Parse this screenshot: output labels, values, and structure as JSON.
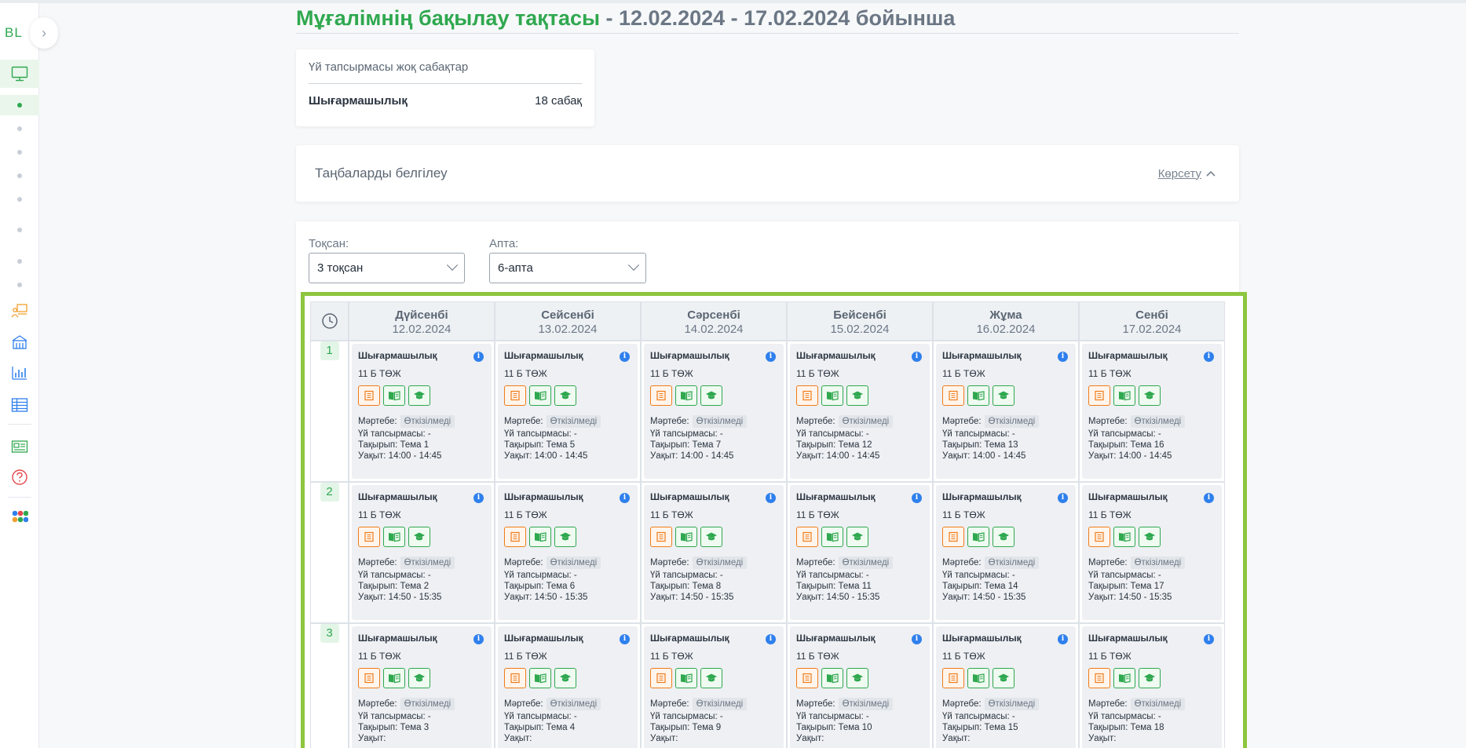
{
  "sidebar": {
    "logo": "BL"
  },
  "page": {
    "title_main": "Мұғалімнің бақылау тақтасы",
    "title_rest": " - 12.02.2024 - 17.02.2024 бойынша"
  },
  "homework_card": {
    "title": "Үй тапсырмасы жоқ сабақтар",
    "subject": "Шығармашылық",
    "count": "18 сабақ"
  },
  "grades_card": {
    "title": "Таңбаларды белгілеу",
    "toggle_label": "Көрсету"
  },
  "filters": {
    "quarter_label": "Тоқсан:",
    "quarter_value": "3 тоқсан",
    "week_label": "Апта:",
    "week_value": "6-апта"
  },
  "schedule": {
    "days": [
      {
        "name": "Дүйсенбі",
        "date": "12.02.2024"
      },
      {
        "name": "Сейсенбі",
        "date": "13.02.2024"
      },
      {
        "name": "Сәрсенбі",
        "date": "14.02.2024"
      },
      {
        "name": "Бейсенбі",
        "date": "15.02.2024"
      },
      {
        "name": "Жұма",
        "date": "16.02.2024"
      },
      {
        "name": "Сенбі",
        "date": "17.02.2024"
      }
    ],
    "lesson_labels": {
      "status_label": "Мәртебе:",
      "status_value": "Өткізілмеді",
      "homework_label": "Үй тапсырмасы:",
      "homework_value": "-",
      "topic_label": "Тақырып:",
      "time_label": "Уақыт:"
    },
    "rows": [
      {
        "number": "1",
        "lessons": [
          {
            "subject": "Шығармашылық",
            "class": "11 Б ТӨЖ",
            "topic": "Тема 1",
            "time": "14:00 - 14:45"
          },
          {
            "subject": "Шығармашылық",
            "class": "11 Б ТӨЖ",
            "topic": "Тема 5",
            "time": "14:00 - 14:45"
          },
          {
            "subject": "Шығармашылық",
            "class": "11 Б ТӨЖ",
            "topic": "Тема 7",
            "time": "14:00 - 14:45"
          },
          {
            "subject": "Шығармашылық",
            "class": "11 Б ТӨЖ",
            "topic": "Тема 12",
            "time": "14:00 - 14:45"
          },
          {
            "subject": "Шығармашылық",
            "class": "11 Б ТӨЖ",
            "topic": "Тема 13",
            "time": "14:00 - 14:45"
          },
          {
            "subject": "Шығармашылық",
            "class": "11 Б ТӨЖ",
            "topic": "Тема 16",
            "time": "14:00 - 14:45"
          }
        ]
      },
      {
        "number": "2",
        "lessons": [
          {
            "subject": "Шығармашылық",
            "class": "11 Б ТӨЖ",
            "topic": "Тема 2",
            "time": "14:50 - 15:35"
          },
          {
            "subject": "Шығармашылық",
            "class": "11 Б ТӨЖ",
            "topic": "Тема 6",
            "time": "14:50 - 15:35"
          },
          {
            "subject": "Шығармашылық",
            "class": "11 Б ТӨЖ",
            "topic": "Тема 8",
            "time": "14:50 - 15:35"
          },
          {
            "subject": "Шығармашылық",
            "class": "11 Б ТӨЖ",
            "topic": "Тема 11",
            "time": "14:50 - 15:35"
          },
          {
            "subject": "Шығармашылық",
            "class": "11 Б ТӨЖ",
            "topic": "Тема 14",
            "time": "14:50 - 15:35"
          },
          {
            "subject": "Шығармашылық",
            "class": "11 Б ТӨЖ",
            "topic": "Тема 17",
            "time": "14:50 - 15:35"
          }
        ]
      },
      {
        "number": "3",
        "lessons": [
          {
            "subject": "Шығармашылық",
            "class": "11 Б ТӨЖ",
            "topic": "Тема 3",
            "time": ""
          },
          {
            "subject": "Шығармашылық",
            "class": "11 Б ТӨЖ",
            "topic": "Тема 4",
            "time": ""
          },
          {
            "subject": "Шығармашылық",
            "class": "11 Б ТӨЖ",
            "topic": "Тема 9",
            "time": ""
          },
          {
            "subject": "Шығармашылық",
            "class": "11 Б ТӨЖ",
            "topic": "Тема 10",
            "time": ""
          },
          {
            "subject": "Шығармашылық",
            "class": "11 Б ТӨЖ",
            "topic": "Тема 15",
            "time": ""
          },
          {
            "subject": "Шығармашылық",
            "class": "11 Б ТӨЖ",
            "topic": "Тема 18",
            "time": ""
          }
        ]
      }
    ]
  },
  "colors": {
    "accent_green": "#2fa84f",
    "highlight_border": "#8dc63f",
    "orange": "#f07c1a",
    "info_blue": "#2f80ed"
  }
}
